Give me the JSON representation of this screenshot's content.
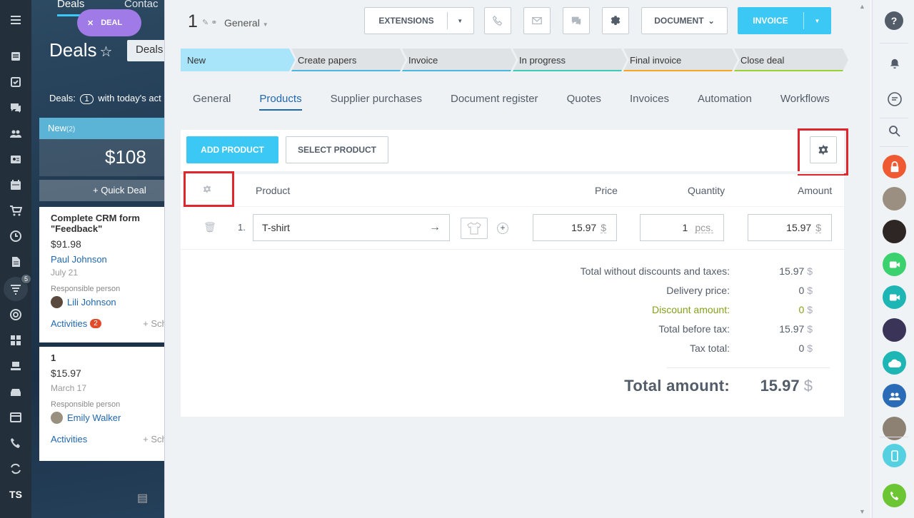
{
  "background": {
    "tabs": {
      "deals": "Deals",
      "contacts": "Contac"
    },
    "deal_pill": "DEAL",
    "title": "Deals",
    "title_select": "Deals",
    "stat_prefix": "Deals:",
    "stat_count": "1",
    "stat_suffix": "with today's act",
    "column": {
      "name": "New",
      "count": "(2)",
      "sum": "$108",
      "quick_deal": "+ Quick Deal"
    },
    "cards": [
      {
        "title": "Complete CRM form \"Feedback\"",
        "price": "$91.98",
        "contact": "Paul Johnson",
        "date": "July 21",
        "responsible_label": "Responsible person",
        "person": "Lili Johnson",
        "activities": "Activities",
        "activities_count": "2",
        "schedule": "+ Sche"
      },
      {
        "title": "1",
        "price": "$15.97",
        "date": "March 17",
        "responsible_label": "Responsible person",
        "person": "Emily Walker",
        "activities": "Activities",
        "schedule": "+ Sche"
      }
    ],
    "nav_badge": "5",
    "nav_initials": "TS"
  },
  "header": {
    "deal_number": "1",
    "category": "General",
    "extensions_label": "EXTENSIONS",
    "document_label": "DOCUMENT",
    "invoice_label": "INVOICE"
  },
  "stages": [
    {
      "label": "New",
      "color": "#a8e4fa"
    },
    {
      "label": "Create papers",
      "color": "#47b8e0"
    },
    {
      "label": "Invoice",
      "color": "#47b8e0"
    },
    {
      "label": "In progress",
      "color": "#3fc9b9"
    },
    {
      "label": "Final invoice",
      "color": "#f5a623"
    },
    {
      "label": "Close deal",
      "color": "#9ad032"
    }
  ],
  "tabs": [
    "General",
    "Products",
    "Supplier purchases",
    "Document register",
    "Quotes",
    "Invoices",
    "Automation",
    "Workflows"
  ],
  "active_tab": "Products",
  "products": {
    "add_label": "ADD PRODUCT",
    "select_label": "SELECT PRODUCT",
    "columns": {
      "product": "Product",
      "price": "Price",
      "quantity": "Quantity",
      "amount": "Amount"
    },
    "rows": [
      {
        "index": "1.",
        "name": "T-shirt",
        "price": "15.97",
        "currency": "$",
        "quantity": "1",
        "unit": "pcs.",
        "amount": "15.97"
      }
    ]
  },
  "totals": {
    "without_discounts_label": "Total without discounts and taxes:",
    "without_discounts": "15.97",
    "delivery_label": "Delivery price:",
    "delivery": "0",
    "discount_label": "Discount amount:",
    "discount": "0",
    "before_tax_label": "Total before tax:",
    "before_tax": "15.97",
    "tax_label": "Tax total:",
    "tax": "0",
    "total_label": "Total amount:",
    "total": "15.97",
    "currency": "$"
  },
  "colors": {
    "accent": "#3bc8f5",
    "link": "#2067b0",
    "highlight": "#e0262c",
    "discount": "#87a01b"
  }
}
